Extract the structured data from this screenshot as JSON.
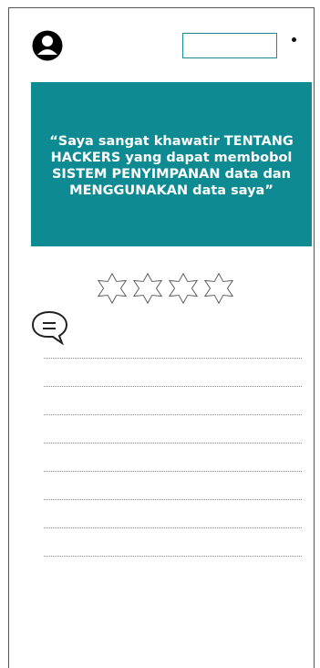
{
  "header": {
    "avatar_icon": "user-avatar-icon",
    "search_input_value": "",
    "menu_icon": "dot-menu-icon"
  },
  "quote": {
    "text": "“Saya sangat khawatir TENTANG HACKERS yang dapat membobol SISTEM PENYIMPANAN data dan MENGGUNAKAN  data saya”",
    "background_color": "#0e8a92",
    "text_color": "#ffffff"
  },
  "rating": {
    "stars_count": 4,
    "filled": 0,
    "star_icon": "six-point-star-outline-icon"
  },
  "comment": {
    "icon": "chat-bubble-icon",
    "lines": 8
  }
}
